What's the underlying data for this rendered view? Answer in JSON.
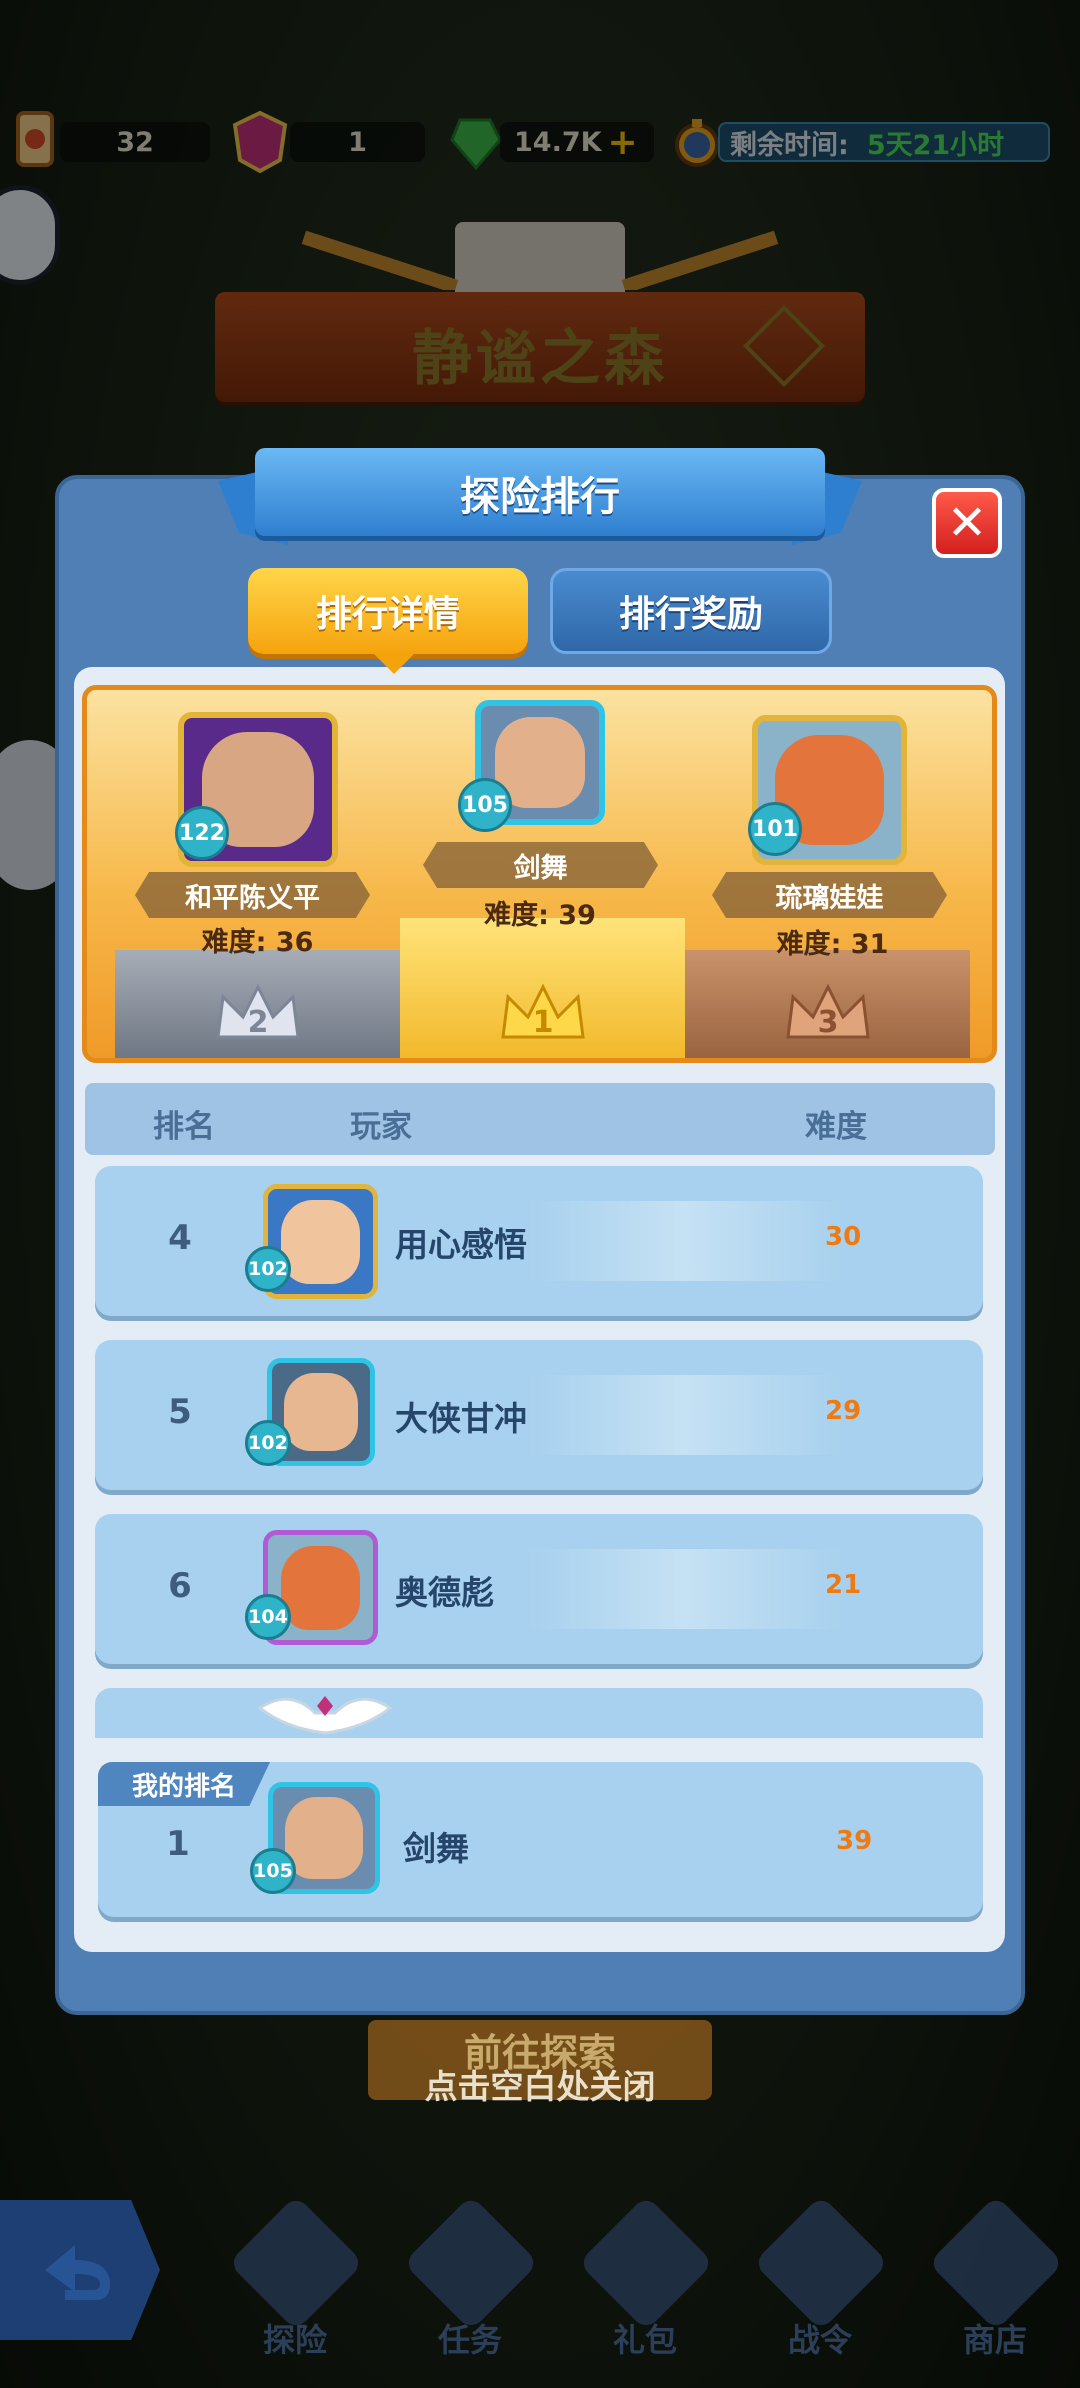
{
  "resources": {
    "scroll_count": "32",
    "gem_count": "1",
    "emerald_count": "14.7K",
    "emerald_add": "+",
    "time_label": "剩余时间:",
    "time_value": "5天21小时"
  },
  "area": {
    "title": "静谧之森"
  },
  "modal": {
    "title": "探险排行",
    "close": "✕",
    "tabs": [
      {
        "label": "排行详情",
        "active": true
      },
      {
        "label": "排行奖励",
        "active": false
      }
    ]
  },
  "podium": [
    {
      "rank": "2",
      "name": "和平陈义平",
      "level": "122",
      "difficulty": "难度: 36"
    },
    {
      "rank": "1",
      "name": "剑舞",
      "level": "105",
      "difficulty": "难度: 39"
    },
    {
      "rank": "3",
      "name": "琉璃娃娃",
      "level": "101",
      "difficulty": "难度: 31"
    }
  ],
  "table": {
    "headers": {
      "rank": "排名",
      "player": "玩家",
      "difficulty": "难度"
    },
    "rows": [
      {
        "rank": "4",
        "name": "用心感悟",
        "level": "102",
        "difficulty": "30"
      },
      {
        "rank": "5",
        "name": "大侠甘冲",
        "level": "102",
        "difficulty": "29"
      },
      {
        "rank": "6",
        "name": "奥德彪",
        "level": "104",
        "difficulty": "21"
      }
    ]
  },
  "my_rank": {
    "tag": "我的排名",
    "rank": "1",
    "name": "剑舞",
    "level": "105",
    "difficulty": "39"
  },
  "behind": {
    "explore_button": "前往探索",
    "close_hint": "点击空白处关闭"
  },
  "nav": {
    "items": [
      {
        "label": "探险",
        "icon": "swords-icon"
      },
      {
        "label": "任务",
        "icon": "quest-icon"
      },
      {
        "label": "礼包",
        "icon": "gift-icon"
      },
      {
        "label": "战令",
        "icon": "shield-icon"
      },
      {
        "label": "商店",
        "icon": "shop-icon"
      }
    ]
  },
  "colors": {
    "modal_blue": "#4f7fb4",
    "tab_active": "#f5a30d",
    "difficulty_orange": "#f07a12",
    "podium_gold": "#f7b84a"
  }
}
